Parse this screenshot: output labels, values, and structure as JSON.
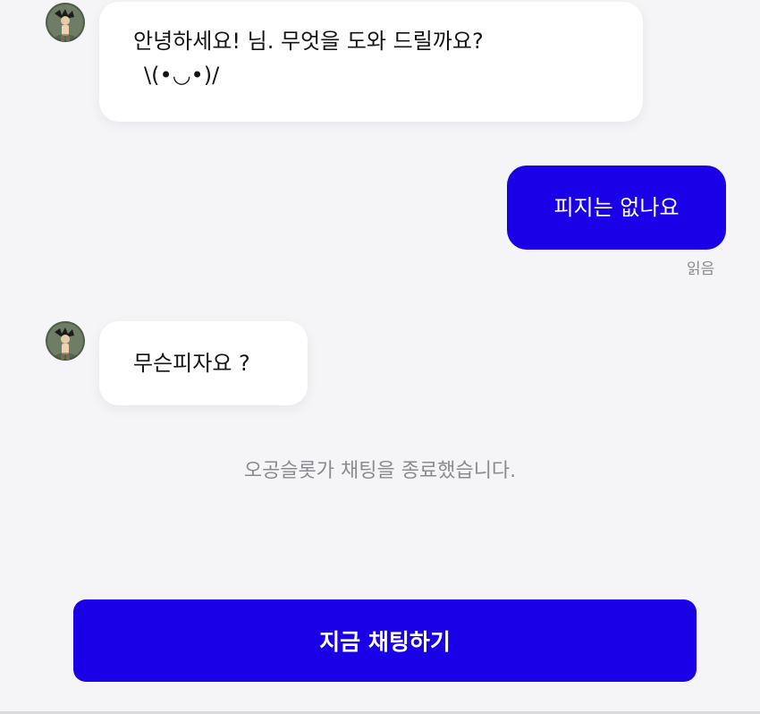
{
  "conversation": {
    "messages": [
      {
        "from": "agent",
        "avatar_icon": "agent-avatar",
        "lines": [
          "안녕하세요! 님. 무엇을 도와 드릴까요?",
          "\\(•◡•)/"
        ]
      },
      {
        "from": "user",
        "text": "피지는 없나요",
        "read_status": "읽음"
      },
      {
        "from": "agent",
        "avatar_icon": "agent-avatar",
        "text": "무슨피자요 ?"
      }
    ],
    "system_notice": "오공슬롯가 채팅을 종료했습니다."
  },
  "cta": {
    "label": "지금 채팅하기"
  },
  "colors": {
    "accent": "#1a00e6",
    "background": "#f5f5f8",
    "bubble_in": "#ffffff",
    "muted_text": "#8a8a8f"
  }
}
